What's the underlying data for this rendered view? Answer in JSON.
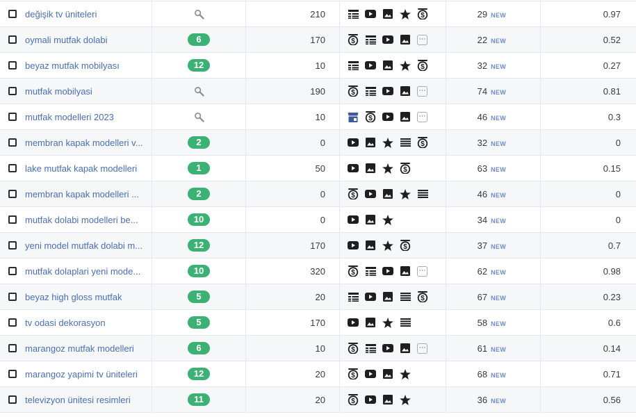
{
  "rows": [
    {
      "keyword": "değişik tv üniteleri",
      "badge": null,
      "volume": "210",
      "features": [
        "table",
        "youtube",
        "image",
        "star",
        "coin"
      ],
      "position": "29",
      "new_label": "NEW",
      "score": "0.97"
    },
    {
      "keyword": "oymali mutfak dolabi",
      "badge": "6",
      "volume": "170",
      "features": [
        "coin",
        "table",
        "youtube",
        "image",
        "more"
      ],
      "position": "22",
      "new_label": "NEW",
      "score": "0.52"
    },
    {
      "keyword": "beyaz mutfak mobilyası",
      "badge": "12",
      "volume": "10",
      "features": [
        "table",
        "youtube",
        "image",
        "star",
        "coin"
      ],
      "position": "32",
      "new_label": "NEW",
      "score": "0.27"
    },
    {
      "keyword": "mutfak mobilyasi",
      "badge": null,
      "volume": "190",
      "features": [
        "coin",
        "table",
        "youtube",
        "image",
        "more"
      ],
      "position": "74",
      "new_label": "NEW",
      "score": "0.81"
    },
    {
      "keyword": "mutfak modelleri 2023",
      "badge": null,
      "volume": "10",
      "features": [
        "shop",
        "coin",
        "youtube",
        "image",
        "more"
      ],
      "position": "46",
      "new_label": "NEW",
      "score": "0.3"
    },
    {
      "keyword": "membran kapak modelleri v...",
      "badge": "2",
      "volume": "0",
      "features": [
        "youtube",
        "image",
        "star",
        "list",
        "coin"
      ],
      "position": "32",
      "new_label": "NEW",
      "score": "0"
    },
    {
      "keyword": "lake mutfak kapak modelleri",
      "badge": "1",
      "volume": "50",
      "features": [
        "youtube",
        "image",
        "star",
        "coin"
      ],
      "position": "63",
      "new_label": "NEW",
      "score": "0.15"
    },
    {
      "keyword": "membran kapak modelleri ...",
      "badge": "2",
      "volume": "0",
      "features": [
        "coin",
        "youtube",
        "image",
        "star",
        "list"
      ],
      "position": "46",
      "new_label": "NEW",
      "score": "0"
    },
    {
      "keyword": "mutfak dolabi modelleri be...",
      "badge": "10",
      "volume": "0",
      "features": [
        "youtube",
        "image",
        "star"
      ],
      "position": "34",
      "new_label": "NEW",
      "score": "0"
    },
    {
      "keyword": "yeni model mutfak dolabi m...",
      "badge": "12",
      "volume": "170",
      "features": [
        "youtube",
        "image",
        "star",
        "coin"
      ],
      "position": "37",
      "new_label": "NEW",
      "score": "0.7"
    },
    {
      "keyword": "mutfak dolaplari yeni mode...",
      "badge": "10",
      "volume": "320",
      "features": [
        "coin",
        "table",
        "youtube",
        "image",
        "more"
      ],
      "position": "62",
      "new_label": "NEW",
      "score": "0.98"
    },
    {
      "keyword": "beyaz high gloss mutfak",
      "badge": "5",
      "volume": "20",
      "features": [
        "table",
        "youtube",
        "image",
        "list",
        "coin"
      ],
      "position": "67",
      "new_label": "NEW",
      "score": "0.23"
    },
    {
      "keyword": "tv odasi dekorasyon",
      "badge": "5",
      "volume": "170",
      "features": [
        "youtube",
        "image",
        "star",
        "list"
      ],
      "position": "58",
      "new_label": "NEW",
      "score": "0.6"
    },
    {
      "keyword": "marangoz mutfak modelleri",
      "badge": "6",
      "volume": "10",
      "features": [
        "coin",
        "table",
        "youtube",
        "image",
        "more"
      ],
      "position": "61",
      "new_label": "NEW",
      "score": "0.14"
    },
    {
      "keyword": "marangoz yapimi tv üniteleri",
      "badge": "12",
      "volume": "20",
      "features": [
        "coin",
        "youtube",
        "image",
        "star"
      ],
      "position": "68",
      "new_label": "NEW",
      "score": "0.71"
    },
    {
      "keyword": "televizyon ünitesi resimleri",
      "badge": "11",
      "volume": "20",
      "features": [
        "coin",
        "youtube",
        "image",
        "star"
      ],
      "position": "36",
      "new_label": "NEW",
      "score": "0.56"
    }
  ],
  "colors": {
    "badge": "#3bb273",
    "link": "#4a6fb5",
    "new_tag": "#6f8ccb",
    "shop_icon": "#3d5a99",
    "icon": "#1f1f1f"
  },
  "icons": {
    "no_badge": "magnifier-icon",
    "table": "table-icon",
    "youtube": "youtube-icon",
    "image": "image-icon",
    "star": "star-icon",
    "coin": "dollar-coin-icon",
    "list": "list-icon",
    "shop": "shopping-icon",
    "more": "more-icon"
  }
}
